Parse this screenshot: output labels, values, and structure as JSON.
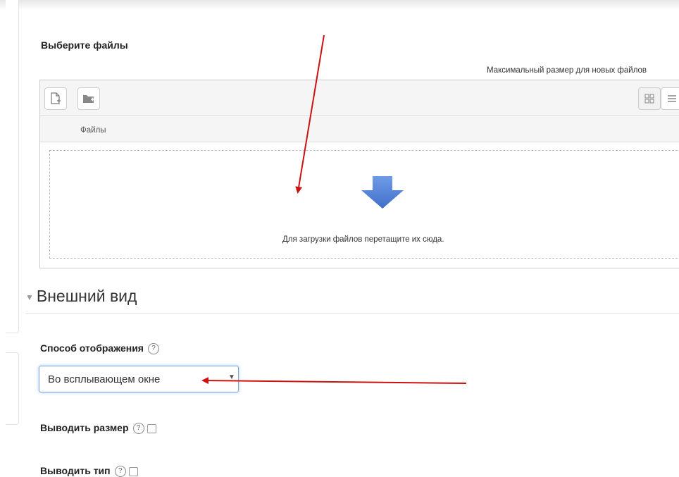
{
  "filepicker": {
    "title": "Выберите файлы",
    "max_size_text": "Максимальный размер для новых файлов",
    "add_button_icon": "file-add-icon",
    "folder_button_icon": "folder-add-icon",
    "view_icons_icon": "grid-view-icon",
    "view_list_icon": "list-view-icon",
    "column_files": "Файлы",
    "drop_text": "Для загрузки файлов перетащите их сюда.",
    "drop_icon": "download-arrow-icon"
  },
  "appearance": {
    "section_title": "Внешний вид",
    "display_label": "Способ отображения",
    "display_value": "Во всплывающем окне",
    "show_size_label": "Выводить размер",
    "show_size_checked": false,
    "show_type_label": "Выводить тип",
    "show_type_checked": false,
    "help_icon": "help-icon"
  },
  "colors": {
    "annotation_arrow": "#cc1111",
    "focus_border": "#7aa7d6",
    "drop_arrow": "#4d7fd6"
  }
}
